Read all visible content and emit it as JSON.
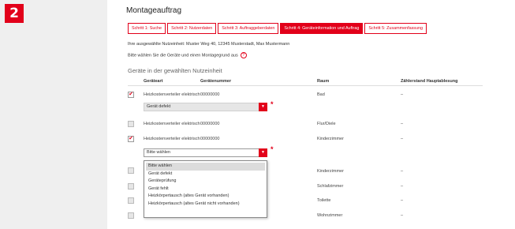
{
  "step_badge": "2",
  "title": "Montageauftrag",
  "tabs": [
    "Schritt 1: Suche",
    "Schritt 2: Nutzerdaten",
    "Schritt 3: Auftraggeberdaten",
    "Schritt 4: Geräteinformation und Auftrag",
    "Schritt 5: Zusammenfassung"
  ],
  "info_line": "Ihre ausgewählte Nutzeinheit: Muster Weg 40, 12345 Musterstadt, Max Mustermann",
  "instruction": "Bitte wählen Sie die Geräte und einen Montagegrund aus",
  "help_symbol": "?",
  "section_title": "Geräte in der gewählten Nutzeinheit",
  "columns": {
    "type": "Geräteart",
    "number": "Gerätenummer",
    "room": "Raum",
    "reading": "Zählerstand Hauptablesung"
  },
  "rows": [
    {
      "type": "Heizkostenverteiler elektrisch",
      "number": "00000000",
      "room": "Bad",
      "reading": "–",
      "checked": true
    },
    {
      "type": "Heizkostenverteiler elektrisch",
      "number": "00000000",
      "room": "Flur/Diele",
      "reading": "–",
      "checked": false
    },
    {
      "type": "Heizkostenverteiler elektrisch",
      "number": "00000000",
      "room": "Kinderzimmer",
      "reading": "–",
      "checked": true
    },
    {
      "type": "",
      "number": "",
      "room": "Kinderzimmer",
      "reading": "–",
      "checked": false
    },
    {
      "type": "",
      "number": "",
      "room": "Schlafzimmer",
      "reading": "–",
      "checked": false
    },
    {
      "type": "",
      "number": "",
      "room": "Toilette",
      "reading": "–",
      "checked": false
    },
    {
      "type": "",
      "number": "",
      "room": "Wohnzimmer",
      "reading": "–",
      "checked": false
    }
  ],
  "reason_selects": [
    {
      "value": "Gerät defekt"
    },
    {
      "value": "Bitte wählen"
    }
  ],
  "required_mark": "*",
  "dropdown_options": [
    "Bitte wählen",
    "Gerät defekt",
    "Geräteprüfung",
    "Gerät fehlt",
    "Heizkörpertausch (altes Gerät vorhanden)",
    "Heizkörpertausch (altes Gerät nicht vorhanden)"
  ],
  "dropdown_selected_index": 0,
  "colors": {
    "accent": "#e2001a",
    "background": "#efefef",
    "panel": "#ffffff"
  },
  "checkmark": "✔"
}
